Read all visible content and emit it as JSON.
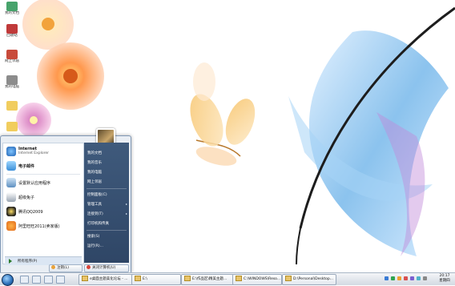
{
  "desktop": {
    "icons": [
      {
        "label": "我的文档",
        "icon": "folder-icon"
      },
      {
        "label": "回收站",
        "icon": "recycle-bin-icon"
      },
      {
        "label": "网上邻居",
        "icon": "network-icon"
      },
      {
        "label": "我的电脑",
        "icon": "computer-icon"
      },
      {
        "label": "",
        "icon": "folder-icon"
      },
      {
        "label": "",
        "icon": "folder-icon"
      }
    ]
  },
  "start_menu": {
    "pinned": [
      {
        "title": "Internet",
        "subtitle": "Internet Explorer",
        "icon": "ie-icon"
      },
      {
        "title": "电子邮件",
        "subtitle": "",
        "icon": "mail-icon"
      }
    ],
    "recent": [
      {
        "label": "设置默认应用程序",
        "icon": "settings-icon"
      },
      {
        "label": "超级兔子",
        "icon": "rabbit-icon"
      },
      {
        "label": "腾讯QQ2009",
        "icon": "qq-icon"
      },
      {
        "label": "阿里旺旺2011(卖家版)",
        "icon": "wangwang-icon"
      }
    ],
    "all_programs": "所有程序(P)",
    "right_items": [
      {
        "label": "我的文档",
        "submenu": false
      },
      {
        "label": "我的音乐",
        "submenu": false
      },
      {
        "label": "我的电脑",
        "submenu": false
      },
      {
        "label": "网上邻居",
        "submenu": false
      },
      {
        "label": "控制面板(C)",
        "submenu": false
      },
      {
        "label": "管理工具",
        "submenu": true
      },
      {
        "label": "连接到(T)",
        "submenu": true
      },
      {
        "label": "打印机和传真",
        "submenu": false
      },
      {
        "label": "搜索(S)",
        "submenu": false
      },
      {
        "label": "运行(R)...",
        "submenu": false
      }
    ],
    "logoff": "注销(L)",
    "shutdown": "关闭计算机(U)"
  },
  "taskbar": {
    "tasks": [
      {
        "label": "e桌面主题美化论坛 - ..."
      },
      {
        "label": "E:\\"
      },
      {
        "label": "E:\\作品区\\精美主题..."
      },
      {
        "label": "C:\\WINDOWS\\Reso..."
      },
      {
        "label": "D:\\Personal\\Desktop..."
      }
    ],
    "clock_time": "20:17",
    "clock_day": "星期四"
  },
  "colors": {
    "start_right_panel": "#3f5a7c",
    "taskbar": "#d3d9e2",
    "menu_border": "#7f97b5"
  }
}
